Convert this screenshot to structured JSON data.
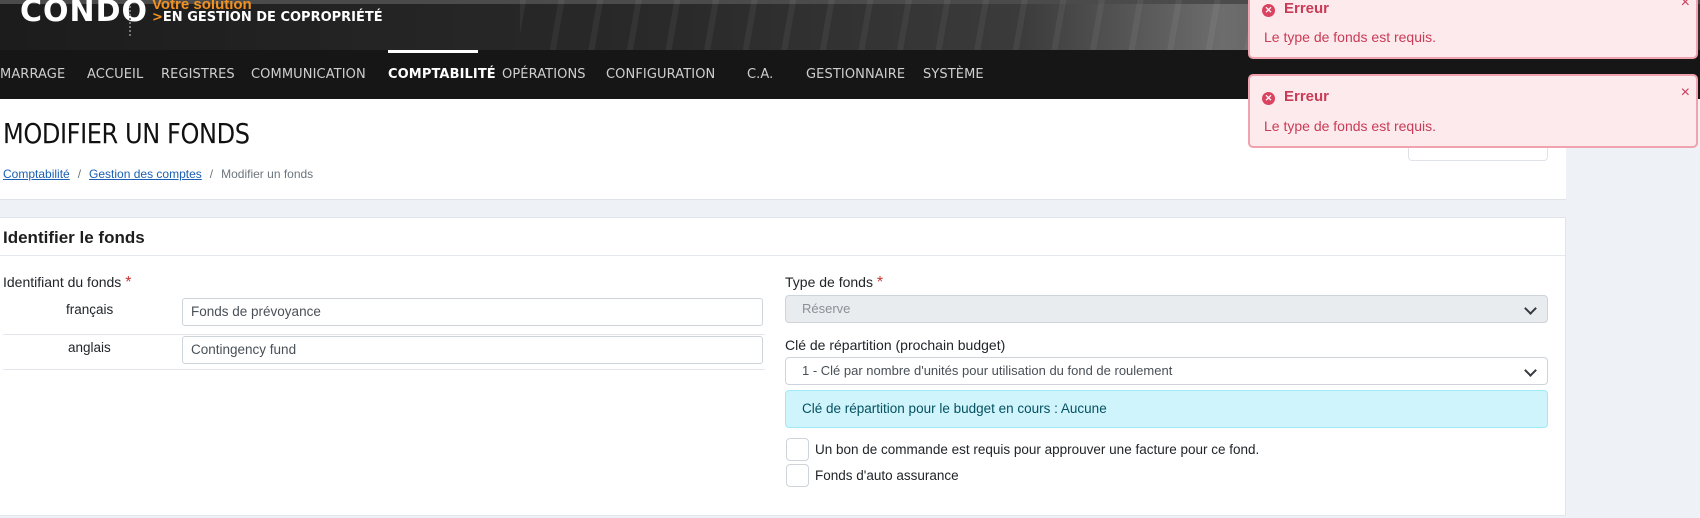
{
  "header": {
    "logo_text": "CONDO",
    "tagline_top": "Votre solution",
    "tagline_bottom": "EN GESTION DE COPROPRIÉTÉ",
    "tagline_chevron": ">"
  },
  "nav": {
    "items": [
      {
        "label": "MARRAGE"
      },
      {
        "label": "ACCUEIL"
      },
      {
        "label": "REGISTRES"
      },
      {
        "label": "COMMUNICATION"
      },
      {
        "label": "COMPTABILITÉ",
        "active": true
      },
      {
        "label": "OPÉRATIONS"
      },
      {
        "label": "CONFIGURATION"
      },
      {
        "label": "C.A."
      },
      {
        "label": "GESTIONNAIRE"
      },
      {
        "label": "SYSTÈME"
      }
    ]
  },
  "page": {
    "title": "MODIFIER UN FONDS",
    "breadcrumb": [
      {
        "label": "Comptabilité",
        "link": true
      },
      {
        "label": "Gestion des comptes",
        "link": true
      },
      {
        "label": "Modifier un fonds",
        "link": false
      }
    ],
    "breadcrumb_sep": "/"
  },
  "form": {
    "card_title": "Identifier le fonds",
    "required_mark": "*",
    "identifier_label": "Identifiant du fonds",
    "lang_fr": "français",
    "lang_en": "anglais",
    "value_fr": "Fonds de prévoyance",
    "value_en": "Contingency fund",
    "type_label": "Type de fonds",
    "type_value": "Réserve",
    "key_label": "Clé de répartition (prochain budget)",
    "key_value": "1 - Clé par nombre d'unités pour utilisation du fond de roulement",
    "info_text": "Clé de répartition pour le budget en cours : Aucune",
    "checkbox_po": "Un bon de commande est requis pour approuver une facture pour ce fond.",
    "checkbox_po_checked": false,
    "checkbox_insurance": "Fonds d'auto assurance",
    "checkbox_insurance_checked": false
  },
  "toasts": [
    {
      "title": "Erreur",
      "message": "Le type de fonds est requis.",
      "close": "×"
    },
    {
      "title": "Erreur",
      "message": "Le type de fonds est requis.",
      "close": "×"
    }
  ],
  "colors": {
    "accent_orange": "#f39220",
    "nav_bg": "#161616",
    "error": "#c93b57",
    "info_bg": "#cff4fc"
  }
}
